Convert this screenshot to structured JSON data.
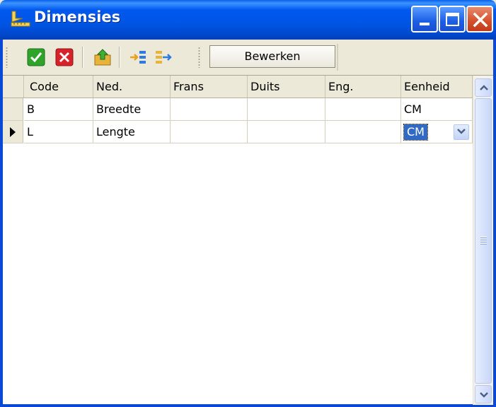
{
  "window": {
    "title": "Dimensies",
    "icon": "ruler-icon",
    "controls": [
      "minimize-icon",
      "maximize-icon",
      "close-icon"
    ]
  },
  "toolbar": {
    "buttons": [
      {
        "name": "confirm",
        "icon": "check-icon",
        "color": "#2FA32A"
      },
      {
        "name": "cancel",
        "icon": "x-icon",
        "color": "#D8222A"
      },
      {
        "name": "export",
        "icon": "folder-up-icon",
        "color": "#E8B33A"
      },
      {
        "name": "import",
        "icon": "arrow-into-list-icon",
        "color": "#2F7BE0"
      },
      {
        "name": "export-list",
        "icon": "arrow-out-list-icon",
        "color": "#E8B33A"
      }
    ],
    "edit_label": "Bewerken"
  },
  "grid": {
    "columns": [
      "Code",
      "Ned.",
      "Frans",
      "Duits",
      "Eng.",
      "Eenheid"
    ],
    "rows": [
      {
        "code": "B",
        "ned": "Breedte",
        "frans": "",
        "duits": "",
        "eng": "",
        "eenheid": "CM"
      },
      {
        "code": "L",
        "ned": "Lengte",
        "frans": "",
        "duits": "",
        "eng": "",
        "eenheid": "CM"
      }
    ],
    "current_row_index": 1,
    "selection_color": "#316AC5"
  }
}
